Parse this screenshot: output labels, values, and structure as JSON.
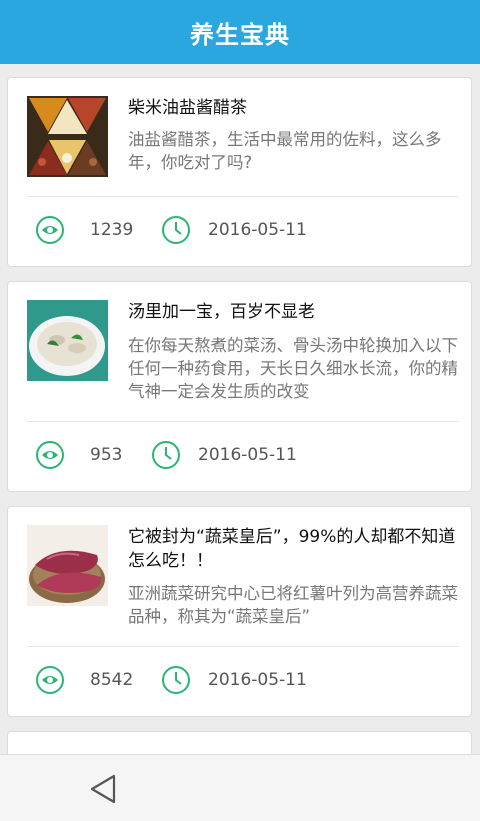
{
  "header": {
    "title": "养生宝典"
  },
  "articles": [
    {
      "title": "柴米油盐酱醋茶",
      "desc": "油盐酱醋茶，生活中最常用的佐料，这么多年，你吃对了吗?",
      "views": "1239",
      "date": "2016-05-11",
      "image": "spices-image"
    },
    {
      "title": "汤里加一宝，百岁不显老",
      "desc": "在你每天熬煮的菜汤、骨头汤中轮换加入以下任何一种药食用，天长日久细水长流，你的精气神一定会发生质的改变",
      "views": "953",
      "date": "2016-05-11",
      "image": "soup-image"
    },
    {
      "title": "它被封为“蔬菜皇后”，99%的人却都不知道怎么吃！！",
      "desc": "亚洲蔬菜研究中心已将红薯叶列为高营养蔬菜品种，称其为“蔬菜皇后”",
      "views": "8542",
      "date": "2016-05-11",
      "image": "sweet-potato-image"
    }
  ],
  "colors": {
    "header": "#2aa7df",
    "icon": "#2bb573"
  },
  "icons": {
    "views": "eye-icon",
    "date": "clock-icon",
    "back": "back-triangle-icon"
  }
}
